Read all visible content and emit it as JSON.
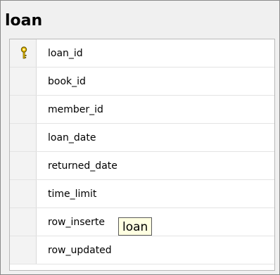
{
  "table": {
    "title": "loan",
    "columns": [
      {
        "name": "loan_id",
        "primary_key": true
      },
      {
        "name": "book_id",
        "primary_key": false
      },
      {
        "name": "member_id",
        "primary_key": false
      },
      {
        "name": "loan_date",
        "primary_key": false
      },
      {
        "name": "returned_date",
        "primary_key": false
      },
      {
        "name": "time_limit",
        "primary_key": false
      },
      {
        "name": "row_inserte",
        "primary_key": false
      },
      {
        "name": "row_updated",
        "primary_key": false
      }
    ]
  },
  "tooltip": {
    "text": "loan"
  },
  "icons": {
    "primary_key": "key-icon"
  },
  "colors": {
    "key_fill": "#f2c300",
    "key_outline": "#6b5a00"
  }
}
